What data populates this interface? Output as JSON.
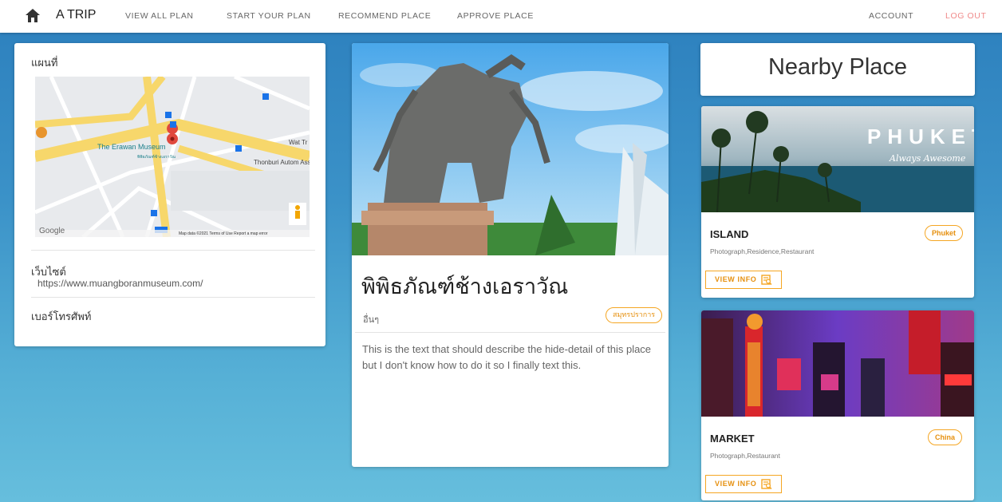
{
  "nav": {
    "brand": "A TRIP",
    "links": [
      "VIEW ALL PLAN",
      "START YOUR PLAN",
      "RECOMMEND PLACE",
      "APPROVE PLACE"
    ],
    "account": "ACCOUNT",
    "logout": "LOG OUT",
    "home_icon": "home-icon"
  },
  "left": {
    "map_title": "แผนที่",
    "map": {
      "place_label": "The Erawan Museum",
      "place_label_th": "พิพิธภัณฑ์ช้างเอราวัณ",
      "nearby_label": "Thonburi Autom Assembly Plant Co",
      "wat_label": "Wat Tr",
      "google": "Google",
      "attrib": "Map data ©2021   Terms of Use   Report a map error"
    },
    "website_label": "เว็บไซต์",
    "website": "https://www.muangboranmuseum.com/",
    "phone_label": "เบอร์โทรศัพท์"
  },
  "main": {
    "title": "พิพิธภัณฑ์ช้างเอราวัณ",
    "category": "อื่นๆ",
    "province": "สมุทรปราการ",
    "description": "This is the text that should describe the hide-detail of this place but I don't know how to do it so I finally text this."
  },
  "nearby": {
    "heading": "Nearby Place",
    "places": [
      {
        "name": "ISLAND",
        "tags": "Photograph,Residence,Restaurant",
        "location": "Phuket",
        "button": "VIEW INFO",
        "image_text": "PHUKET",
        "image_script": "Always Awesome"
      },
      {
        "name": "MARKET",
        "tags": "Photograph,Restaurant",
        "location": "China",
        "button": "VIEW INFO"
      }
    ]
  },
  "colors": {
    "accent": "#f5a623",
    "logout": "#f08a8a",
    "nav_bg": "#ffffff"
  }
}
